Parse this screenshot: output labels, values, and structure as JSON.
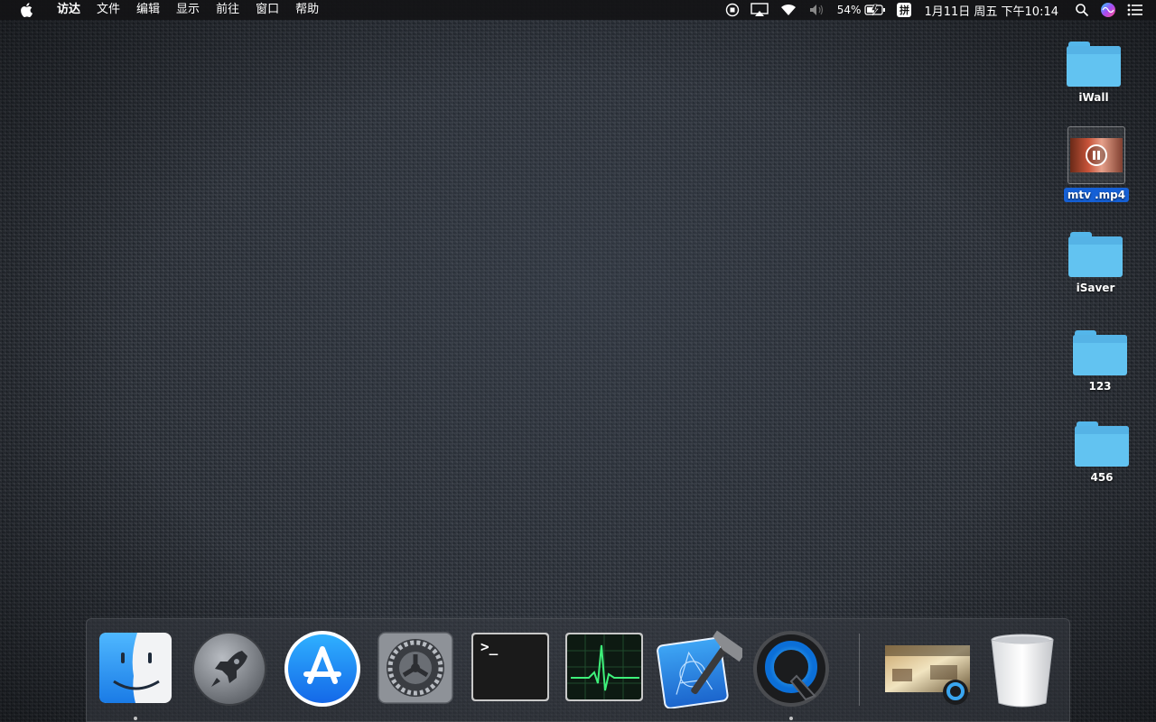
{
  "menubar": {
    "apple_icon": "apple-logo-icon",
    "app_name": "访达",
    "menus": [
      "文件",
      "编辑",
      "显示",
      "前往",
      "窗口",
      "帮助"
    ],
    "status": {
      "battery_percent": "54%",
      "ime_label": "拼",
      "clock": "1月11日 周五 下午10:14",
      "icons": [
        "record-icon",
        "airplay-icon",
        "wifi-icon",
        "volume-muted-icon",
        "battery-charging-icon",
        "spotlight-search-icon",
        "siri-icon",
        "notification-center-icon"
      ]
    }
  },
  "desktop": {
    "icons": [
      {
        "label": "iWall",
        "kind": "folder",
        "selected": false
      },
      {
        "label": "mtv .mp4",
        "kind": "video",
        "selected": true
      },
      {
        "label": "iSaver",
        "kind": "folder",
        "selected": false
      },
      {
        "label": "123",
        "kind": "folder",
        "selected": false
      },
      {
        "label": "456",
        "kind": "folder",
        "selected": false
      }
    ]
  },
  "dock": {
    "apps": [
      {
        "name": "finder-icon",
        "running": true
      },
      {
        "name": "launchpad-icon",
        "running": false
      },
      {
        "name": "app-store-icon",
        "running": false
      },
      {
        "name": "system-preferences-icon",
        "running": false
      },
      {
        "name": "terminal-icon",
        "running": false
      },
      {
        "name": "activity-monitor-icon",
        "running": false
      },
      {
        "name": "xcode-icon",
        "running": false
      },
      {
        "name": "quicktime-player-icon",
        "running": true
      }
    ],
    "terminal_prompt": ">_",
    "others": [
      {
        "name": "video-stack-icon"
      },
      {
        "name": "trash-icon"
      }
    ]
  }
}
